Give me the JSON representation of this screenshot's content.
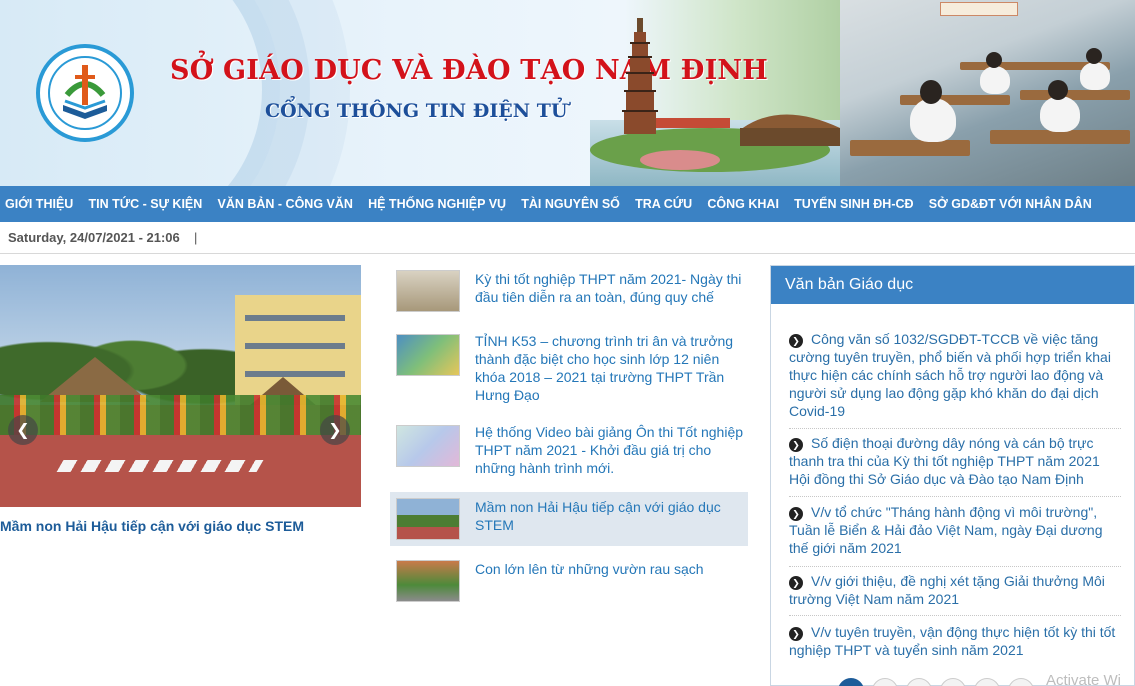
{
  "header": {
    "org_title": "SỞ GIÁO DỤC VÀ ĐÀO TẠO NAM ĐỊNH",
    "portal_title": "CỔNG THÔNG TIN ĐIỆN TỬ"
  },
  "nav": {
    "items": [
      "GIỚI THIỆU",
      "TIN TỨC - SỰ KIỆN",
      "VĂN BẢN - CÔNG VĂN",
      "HỆ THỐNG NGHIỆP VỤ",
      "TÀI NGUYÊN SỐ",
      "TRA CỨU",
      "CÔNG KHAI",
      "TUYỂN SINH ĐH-CĐ",
      "SỞ GD&ĐT VỚI NHÂN DÂN"
    ]
  },
  "datebar": {
    "date": "Saturday, 24/07/2021 - 21:06",
    "separator": "|"
  },
  "slider": {
    "prev": "❮",
    "next": "❯",
    "caption": "Mầm non Hải Hậu tiếp cận với giáo dục STEM"
  },
  "news": [
    {
      "title": "Kỳ thi tốt nghiệp THPT năm 2021- Ngày thi đầu tiên diễn ra an toàn, đúng quy chế"
    },
    {
      "title": "TỈNH K53 – chương trình tri ân và trưởng thành đặc biệt cho học sinh lớp 12 niên khóa 2018 – 2021 tại trường THPT Trần Hưng Đạo"
    },
    {
      "title": "Hệ thống Video bài giảng Ôn thi Tốt nghiệp THPT năm 2021 - Khởi đầu giá trị cho những hành trình mới."
    },
    {
      "title": "Mầm non Hải Hậu tiếp cận với giáo dục STEM"
    },
    {
      "title": "Con lớn lên từ những vườn rau sạch"
    }
  ],
  "sidebar": {
    "heading": "Văn bản Giáo dục",
    "docs": [
      "Công văn số 1032/SGDĐT-TCCB về việc tăng cường tuyên truyền, phổ biến và phối hợp triển khai thực hiện các chính sách hỗ trợ người lao động và người sử dụng lao động gặp khó khăn do đại dịch Covid-19",
      "Số điện thoại đường dây nóng và cán bộ trực thanh tra thi của Kỳ thi tốt nghiệp THPT năm 2021 Hội đồng thi Sở Giáo dục và Đào tạo Nam Định",
      "V/v tổ chức \"Tháng hành động vì môi trường\", Tuần lễ Biển & Hải đảo Việt Nam, ngày Đại dương thế giới năm 2021",
      "V/v giới thiệu, đề nghị xét tặng Giải thưởng Môi trường Việt Nam năm 2021",
      "V/v tuyên truyền, vận động thực hiện tốt kỳ thi tốt nghiệp THPT và tuyển sinh năm 2021"
    ]
  },
  "watermark": "Activate Wi",
  "colors": {
    "nav_bg": "#3b82c4",
    "title_red": "#d3121a",
    "link_blue": "#2477b8"
  }
}
